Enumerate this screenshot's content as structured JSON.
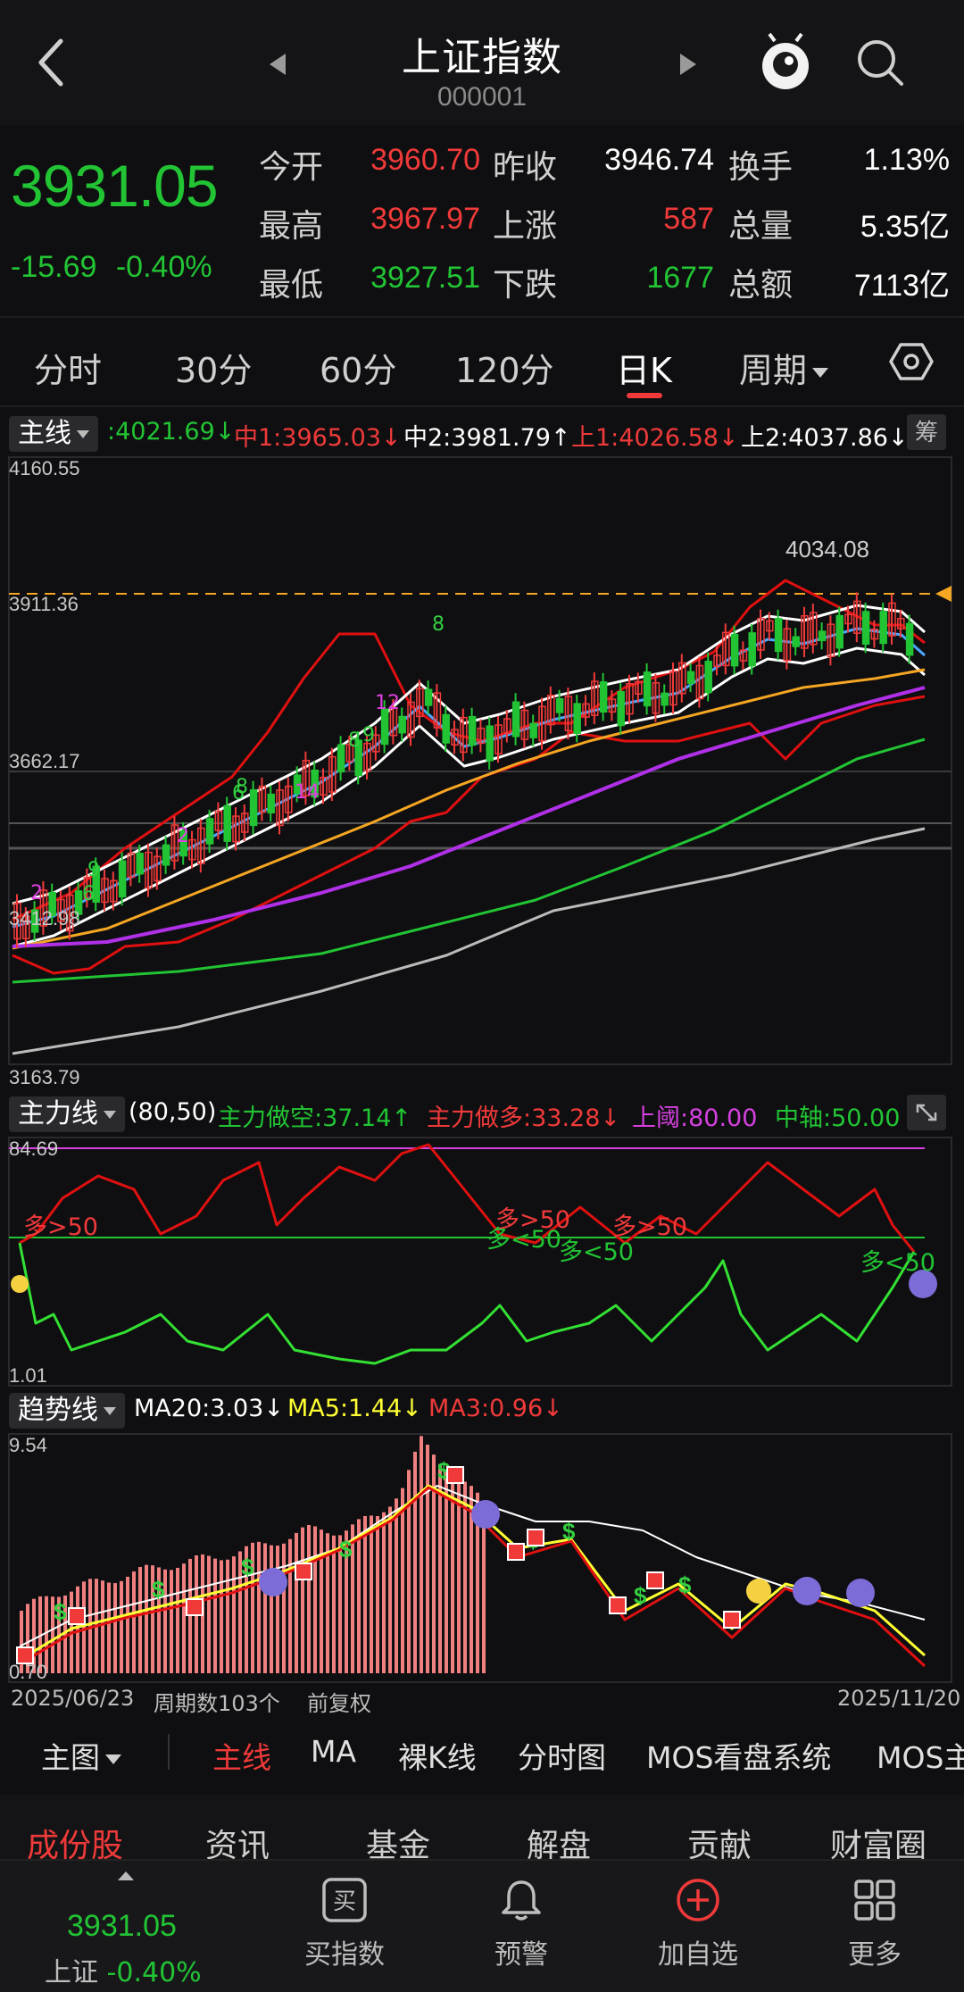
{
  "header": {
    "title": "上证指数",
    "code": "000001"
  },
  "quote": {
    "price": "3931.05",
    "change": "-15.69",
    "change_pct": "-0.40%",
    "stats": [
      {
        "label": "今开",
        "value": "3960.70",
        "color": "#f03a3a"
      },
      {
        "label": "昨收",
        "value": "3946.74",
        "color": "#ffffff"
      },
      {
        "label": "换手",
        "value": "1.13%",
        "color": "#ffffff"
      },
      {
        "label": "最高",
        "value": "3967.97",
        "color": "#f03a3a"
      },
      {
        "label": "上涨",
        "value": "587",
        "color": "#f03a3a"
      },
      {
        "label": "总量",
        "value": "5.35亿",
        "color": "#ffffff"
      },
      {
        "label": "最低",
        "value": "3927.51",
        "color": "#22c434"
      },
      {
        "label": "下跌",
        "value": "1677",
        "color": "#22c434"
      },
      {
        "label": "总额",
        "value": "7113亿",
        "color": "#ffffff"
      }
    ]
  },
  "period_tabs": [
    "分时",
    "30分",
    "60分",
    "120分",
    "日K",
    "周期"
  ],
  "active_period": "日K",
  "main_chart": {
    "selector": "主线",
    "legend": [
      {
        "text": ":4021.69↓",
        "color": "#22c434"
      },
      {
        "text": "中1:3965.03↓",
        "color": "#f03a3a"
      },
      {
        "text": "中2:3981.79↑",
        "color": "#ffffff"
      },
      {
        "text": "上1:4026.58↓",
        "color": "#f03a3a"
      },
      {
        "text": "上2:4037.86↓",
        "color": "#ffffff"
      }
    ],
    "badge": "筹",
    "y_labels": [
      "4160.55",
      "3911.36",
      "3662.17",
      "3412.98",
      "3163.79"
    ],
    "peak_label": "4034.08",
    "markers": [
      "2",
      "6",
      "9",
      "2",
      "6",
      "8",
      "14",
      "8",
      "9",
      "12",
      "8"
    ]
  },
  "chart_data": [
    {
      "type": "line",
      "title": "",
      "ylim": [
        3163.79,
        4160.55
      ],
      "y_ticks": [
        4160.55,
        3911.36,
        3662.17,
        3412.98,
        3163.79
      ],
      "reference_line": 3931.05,
      "x_range": [
        "2025/06/23",
        "2025/11/20"
      ],
      "series": []
    },
    {
      "type": "line",
      "title": "主力线",
      "ylim": [
        1.01,
        84.69
      ],
      "series": [
        {
          "name": "主力做空",
          "last": 37.14
        },
        {
          "name": "主力做多",
          "last": 33.28
        },
        {
          "name": "上阈",
          "last": 80.0
        },
        {
          "name": "中轴",
          "last": 50.0
        }
      ]
    },
    {
      "type": "bar",
      "title": "趋势线",
      "ylim": [
        0.7,
        9.54
      ],
      "series": [
        {
          "name": "MA20",
          "last": 3.03
        },
        {
          "name": "MA5",
          "last": 1.44
        },
        {
          "name": "MA3",
          "last": 0.96
        }
      ]
    }
  ],
  "zhuli": {
    "selector": "主力线",
    "params": "(80,50)",
    "legend": [
      {
        "text": "主力做空:37.14↑",
        "color": "#22c434"
      },
      {
        "text": "主力做多:33.28↓",
        "color": "#f03a3a"
      },
      {
        "text": "上阈:80.00",
        "color": "#d640e0"
      },
      {
        "text": "中轴:50.00",
        "color": "#22c434"
      }
    ],
    "y_top": "84.69",
    "y_bottom": "1.01",
    "annotations": [
      "多>50",
      "多>50",
      "多<50",
      "多<50",
      "多>50",
      "多<50"
    ]
  },
  "qushi": {
    "selector": "趋势线",
    "legend": [
      {
        "text": "MA20:3.03↓",
        "color": "#ffffff"
      },
      {
        "text": "MA5:1.44↓",
        "color": "#ffff33"
      },
      {
        "text": "MA3:0.96↓",
        "color": "#f03a3a"
      }
    ],
    "y_top": "9.54",
    "y_bottom": "0.70"
  },
  "footer_info": {
    "start_date": "2025/06/23",
    "periods": "周期数103个",
    "adjust": "前复权",
    "end_date": "2025/11/20"
  },
  "indicator_bar": {
    "main_selector": "主图",
    "items": [
      "主线",
      "MA",
      "裸K线",
      "分时图",
      "MOS看盘系统",
      "MOS主"
    ],
    "active": "主线"
  },
  "section_tabs": [
    "成份股",
    "资讯",
    "基金",
    "解盘",
    "贡献",
    "财富圈"
  ],
  "bottom_nav": {
    "price": "3931.05",
    "name": "上证",
    "pct": "-0.40%",
    "items": [
      "买指数",
      "预警",
      "加自选",
      "更多"
    ],
    "buy_glyph": "买"
  },
  "colors": {
    "up": "#f03a3a",
    "down": "#22c434",
    "bg": "#0f0f11"
  }
}
